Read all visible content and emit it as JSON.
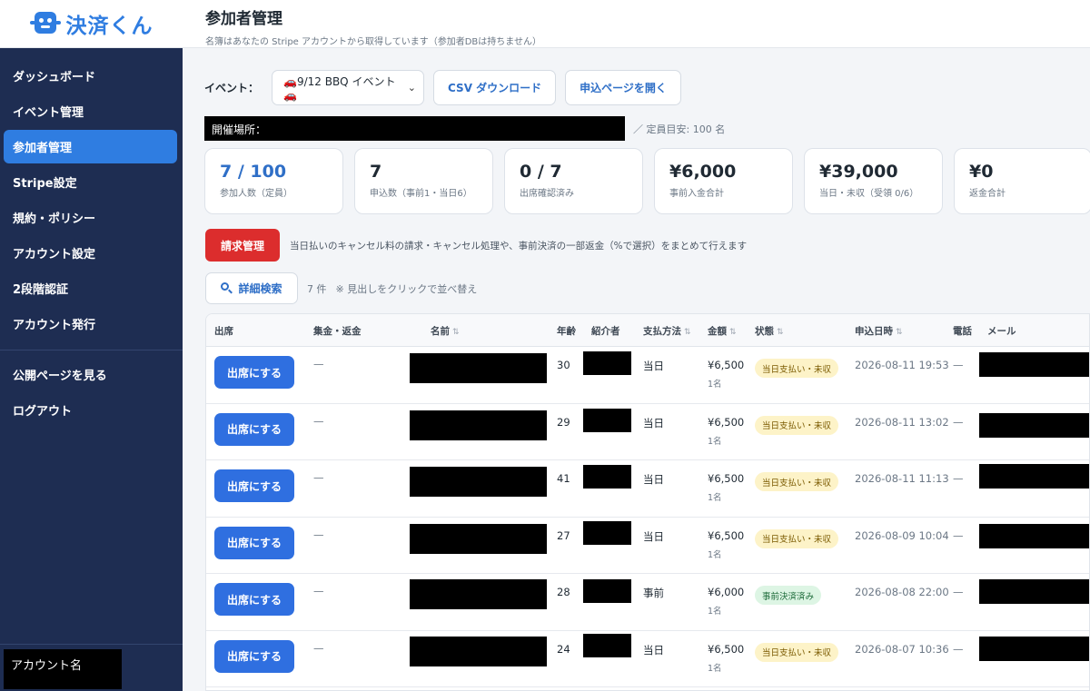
{
  "app": {
    "logo_text": "決済くん"
  },
  "sidebar": {
    "items": [
      {
        "label": "ダッシュボード",
        "active": false
      },
      {
        "label": "イベント管理",
        "active": false
      },
      {
        "label": "参加者管理",
        "active": true
      },
      {
        "label": "Stripe設定",
        "active": false
      },
      {
        "label": "規約・ポリシー",
        "active": false
      },
      {
        "label": "アカウント設定",
        "active": false
      },
      {
        "label": "2段階認証",
        "active": false
      },
      {
        "label": "アカウント発行",
        "active": false
      }
    ],
    "secondary": [
      {
        "label": "公開ページを見る"
      },
      {
        "label": "ログアウト"
      }
    ],
    "account_name": "アカウント名"
  },
  "header": {
    "title": "参加者管理",
    "subtitle": "名簿はあなたの Stripe アカウントから取得しています（参加者DBは持ちません）"
  },
  "toolbar": {
    "event_label": "イベント：",
    "event_selected": "🚗9/12 BBQ イベント🚗",
    "csv_label": "CSV ダウンロード",
    "open_page_label": "申込ページを開く"
  },
  "venue": {
    "label": "開催場所：",
    "capacity": "／ 定員目安: 100 名"
  },
  "stats": [
    {
      "value": "7 / 100",
      "label": "参加人数（定員）"
    },
    {
      "value": "7",
      "label": "申込数（事前1・当日6）"
    },
    {
      "value": "0 / 7",
      "label": "出席確認済み"
    },
    {
      "value": "¥6,000",
      "label": "事前入金合計"
    },
    {
      "value": "¥39,000",
      "label": "当日・未収（受領 0/6）"
    },
    {
      "value": "¥0",
      "label": "返金合計"
    }
  ],
  "billing": {
    "button_label": "請求管理",
    "description": "当日払いのキャンセル料の請求・キャンセル処理や、事前決済の一部返金（%で選択）をまとめて行えます"
  },
  "search": {
    "button_label": "詳細検索",
    "count": "7 件",
    "hint": "※ 見出しをクリックで並べ替え"
  },
  "table": {
    "headers": {
      "attend": "出席",
      "collect": "集金・返金",
      "name": "名前",
      "age": "年齢",
      "referrer": "紹介者",
      "payment": "支払方法",
      "amount": "金額",
      "status": "状態",
      "date": "申込日時",
      "phone": "電話",
      "email": "メール"
    },
    "sort_mark": "⇅",
    "attend_button": "出席にする",
    "rows": [
      {
        "collect": "—",
        "age": "30",
        "payment": "当日",
        "amount": "¥6,500",
        "qty": "1名",
        "status": "当日支払い・未収",
        "status_type": "unpaid",
        "date": "2026-08-11 19:53",
        "phone": "—"
      },
      {
        "collect": "—",
        "age": "29",
        "payment": "当日",
        "amount": "¥6,500",
        "qty": "1名",
        "status": "当日支払い・未収",
        "status_type": "unpaid",
        "date": "2026-08-11 13:02",
        "phone": "—"
      },
      {
        "collect": "—",
        "age": "41",
        "payment": "当日",
        "amount": "¥6,500",
        "qty": "1名",
        "status": "当日支払い・未収",
        "status_type": "unpaid",
        "date": "2026-08-11 11:13",
        "phone": "—"
      },
      {
        "collect": "—",
        "age": "27",
        "payment": "当日",
        "amount": "¥6,500",
        "qty": "1名",
        "status": "当日支払い・未収",
        "status_type": "unpaid",
        "date": "2026-08-09 10:04",
        "phone": "—"
      },
      {
        "collect": "—",
        "age": "28",
        "payment": "事前",
        "amount": "¥6,000",
        "qty": "1名",
        "status": "事前決済済み",
        "status_type": "paid",
        "date": "2026-08-08 22:00",
        "phone": "—"
      },
      {
        "collect": "—",
        "age": "24",
        "payment": "当日",
        "amount": "¥6,500",
        "qty": "1名",
        "status": "当日支払い・未収",
        "status_type": "unpaid",
        "date": "2026-08-07 10:36",
        "phone": "—"
      }
    ]
  },
  "colors": {
    "sidebar_bg": "#1e2d52",
    "accent": "#2f7de1",
    "danger": "#dc2d2d",
    "badge_unpaid": "#fdf3c8",
    "badge_paid": "#ddf5e4"
  }
}
